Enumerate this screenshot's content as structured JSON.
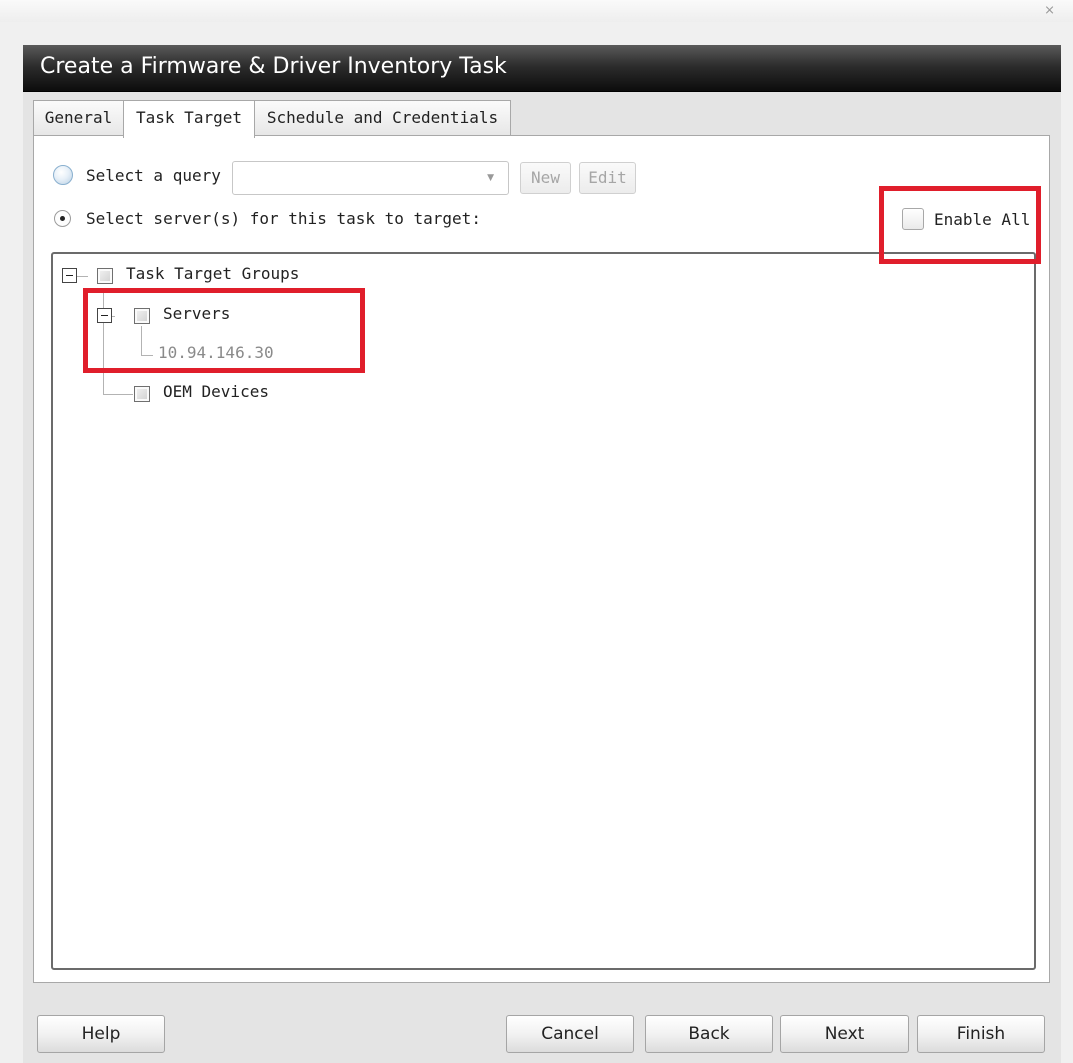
{
  "window": {
    "close_glyph": "⨯"
  },
  "dialog": {
    "title": "Create a Firmware & Driver Inventory Task"
  },
  "tabs": [
    {
      "label": "General",
      "active": false
    },
    {
      "label": "Task Target",
      "active": true
    },
    {
      "label": "Schedule and Credentials",
      "active": false
    }
  ],
  "query": {
    "label": "Select a query",
    "selected": false,
    "dropdown_value": "",
    "new_label": "New",
    "edit_label": "Edit"
  },
  "servers_option": {
    "label": "Select server(s)  for this task to target:",
    "selected": true
  },
  "enable_all": {
    "label": "Enable All",
    "checked": false
  },
  "tree": {
    "root": {
      "label": "Task Target Groups",
      "checked": false,
      "expanded": true
    },
    "servers": {
      "label": "Servers",
      "checked": false,
      "expanded": true
    },
    "server_ip": {
      "label": "10.94.146.30"
    },
    "oem": {
      "label": "OEM Devices",
      "checked": false
    }
  },
  "highlight_color": "#e01e2b",
  "footer": {
    "help": "Help",
    "cancel": "Cancel",
    "back": "Back",
    "next": "Next",
    "finish": "Finish"
  }
}
